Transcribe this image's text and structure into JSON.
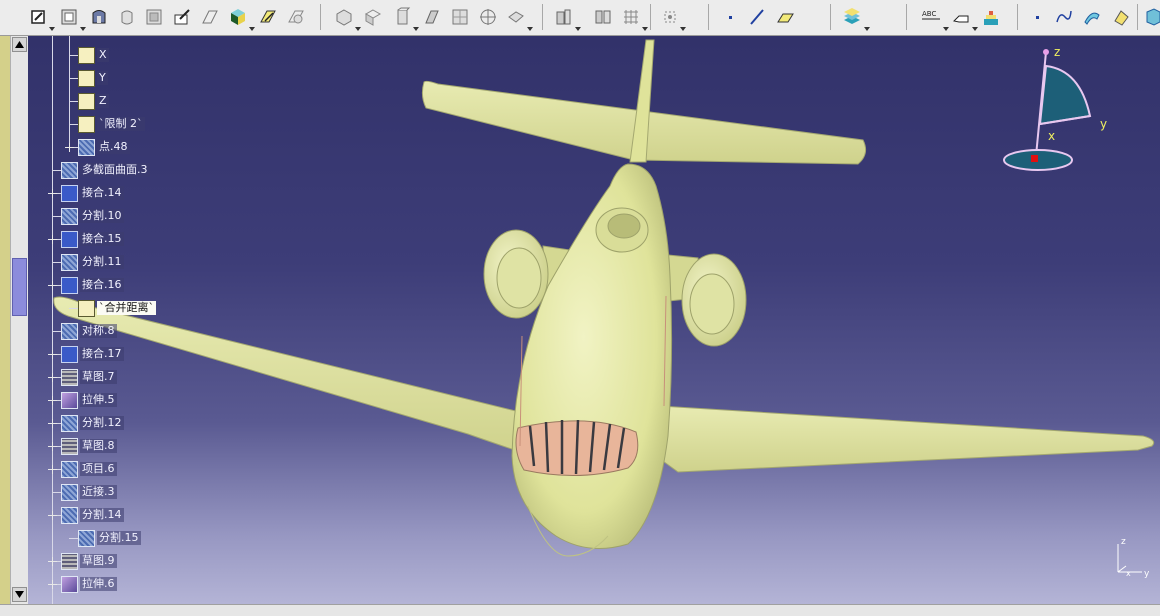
{
  "toolbar": {
    "buttons": [
      "sketcher-icon",
      "plane-icon",
      "part-body-icon",
      "extrude-icon",
      "pocket-icon",
      "sketch-edit-icon",
      "wireframe-icon",
      "cube-color-icon",
      "surface-edit-icon",
      "surface-join-icon",
      "view-iso-icon",
      "view-front-icon",
      "view-top-icon",
      "view-side-icon",
      "view-multi-icon",
      "view-target-icon",
      "view-rotate-icon",
      "measure-icon",
      "measure-grid-icon",
      "analysis-icon",
      "grid-icon",
      "point-icon",
      "line-icon",
      "plane-surface-icon",
      "layers-icon",
      "abc-text-icon",
      "annotation-icon",
      "material-icon",
      "curve-point-icon",
      "spline-icon",
      "sweep-icon",
      "fill-icon",
      "extra-icon"
    ]
  },
  "tree": {
    "items": [
      {
        "label": "X",
        "icon": "doc-icon",
        "boxed": false
      },
      {
        "label": "Y",
        "icon": "doc-icon",
        "boxed": false
      },
      {
        "label": "Z",
        "icon": "doc-icon",
        "boxed": false
      },
      {
        "label": "`限制 2`",
        "icon": "doc-icon",
        "boxed": false
      },
      {
        "label": "点.48",
        "icon": "point-icon",
        "boxed": false
      },
      {
        "label": "多截面曲面.3",
        "icon": "multisection-icon",
        "boxed": false
      },
      {
        "label": "接合.14",
        "icon": "join-icon",
        "boxed": false
      },
      {
        "label": "分割.10",
        "icon": "split-icon",
        "boxed": false
      },
      {
        "label": "接合.15",
        "icon": "join-icon",
        "boxed": false
      },
      {
        "label": "分割.11",
        "icon": "split-icon",
        "boxed": false
      },
      {
        "label": "接合.16",
        "icon": "join-icon",
        "boxed": false
      },
      {
        "label": "`合并距离`",
        "icon": "doc-icon",
        "boxed": true
      },
      {
        "label": "对称.8",
        "icon": "symmetry-icon",
        "boxed": false
      },
      {
        "label": "接合.17",
        "icon": "join-icon",
        "boxed": false
      },
      {
        "label": "草图.7",
        "icon": "sketch-icon",
        "boxed": false
      },
      {
        "label": "拉伸.5",
        "icon": "extrude-icon",
        "boxed": false
      },
      {
        "label": "分割.12",
        "icon": "split-icon",
        "boxed": false
      },
      {
        "label": "草图.8",
        "icon": "sketch-icon",
        "boxed": false
      },
      {
        "label": "项目.6",
        "icon": "project-icon",
        "boxed": false
      },
      {
        "label": "近接.3",
        "icon": "near-icon",
        "boxed": false
      },
      {
        "label": "分割.14",
        "icon": "split-icon",
        "boxed": false
      },
      {
        "label": "分割.15",
        "icon": "split-icon",
        "boxed": false
      },
      {
        "label": "草图.9",
        "icon": "sketch-icon",
        "boxed": false
      },
      {
        "label": "拉伸.6",
        "icon": "extrude-icon",
        "boxed": false
      }
    ]
  },
  "compass": {
    "x_label": "x",
    "y_label": "y",
    "z_label": "z"
  },
  "axis_triad": {
    "x_label": "x",
    "y_label": "y",
    "z_label": "z"
  },
  "colors": {
    "background_top": "#32326a",
    "background_bottom": "#b4b4d6",
    "aircraft": "#e4e8a6",
    "cockpit_glass": "#e8b59a",
    "compass": "#1d5f78",
    "label_yellow": "#f0f060"
  }
}
